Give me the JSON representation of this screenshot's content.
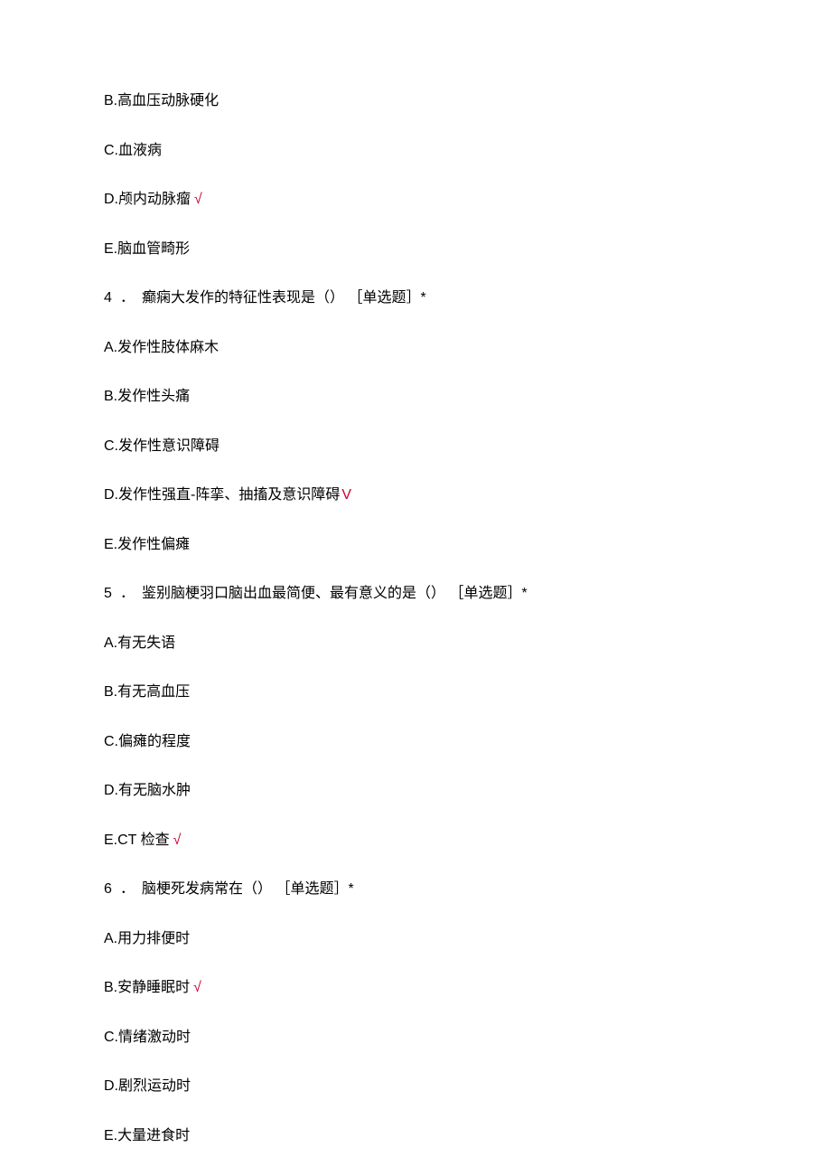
{
  "lines": {
    "q3_optB": "B.高血压动脉硬化",
    "q3_optC": "C.血液病",
    "q3_optD_text": "D.颅内动脉瘤",
    "q3_optD_mark": "√",
    "q3_optE": "E.脑血管畸形",
    "q4_num": "4",
    "q4_dot": "．",
    "q4_text": "癫痫大发作的特征性表现是（） ［单选题］*",
    "q4_optA": "A.发作性肢体麻木",
    "q4_optB": "B.发作性头痛",
    "q4_optC": "C.发作性意识障碍",
    "q4_optD_text": "D.发作性强直-阵挛、抽搐及意识障碍",
    "q4_optD_mark": "V",
    "q4_optE": "E.发作性偏瘫",
    "q5_num": "5",
    "q5_dot": "．",
    "q5_text": "鉴别脑梗羽口脑出血最简便、最有意义的是（） ［单选题］*",
    "q5_optA": "A.有无失语",
    "q5_optB": "B.有无高血压",
    "q5_optC": "C.偏瘫的程度",
    "q5_optD": "D.有无脑水肿",
    "q5_optE_text": "E.CT 检查",
    "q5_optE_mark": "√",
    "q6_num": "6",
    "q6_dot": "．",
    "q6_text": "脑梗死发病常在（） ［单选题］*",
    "q6_optA": "A.用力排便时",
    "q6_optB_text": "B.安静睡眠时",
    "q6_optB_mark": "√",
    "q6_optC": "C.情绪激动时",
    "q6_optD": "D.剧烈运动时",
    "q6_optE": "E.大量进食时"
  }
}
